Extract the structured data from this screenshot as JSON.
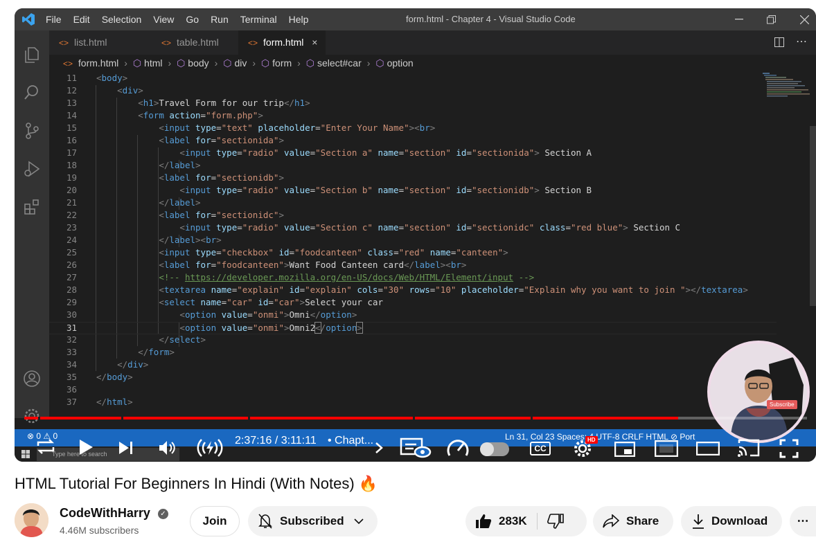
{
  "vscode": {
    "menus": [
      "File",
      "Edit",
      "Selection",
      "View",
      "Go",
      "Run",
      "Terminal",
      "Help"
    ],
    "window_title": "form.html - Chapter 4 - Visual Studio Code",
    "tabs": [
      {
        "label": "list.html",
        "active": false
      },
      {
        "label": "table.html",
        "active": false
      },
      {
        "label": "form.html",
        "active": true
      }
    ],
    "tab_close": "×",
    "breadcrumb": [
      "form.html",
      "html",
      "body",
      "div",
      "form",
      "select#car",
      "option"
    ],
    "current_line": 31
  },
  "video": {
    "timecode": "2:37:16 / 3:11:11",
    "chapter": "• Chapt...",
    "progress_fraction": 0.835,
    "hd_badge": "HD",
    "cc_label": "CC",
    "status_left": "⊗ 0 ⚠ 0",
    "status_mid": "Ln 31, Col 23   Spaces: 4   UTF-8   CRLF   HTML   ⊘ Port",
    "taskbar_search": "Type here to search",
    "webcam_subscribe": "Subscribe"
  },
  "title": "HTML Tutorial For Beginners In Hindi (With Notes) 🔥",
  "channel": {
    "name": "CodeWithHarry",
    "subscribers": "4.46M subscribers"
  },
  "actions": {
    "join": "Join",
    "subscribed": "Subscribed",
    "likes": "283K",
    "share": "Share",
    "download": "Download",
    "more": "⋯"
  },
  "colors": {
    "youtube_red": "#ff0000",
    "vscode_blue": "#1a68c0",
    "editor_bg": "#1e1e1e"
  }
}
